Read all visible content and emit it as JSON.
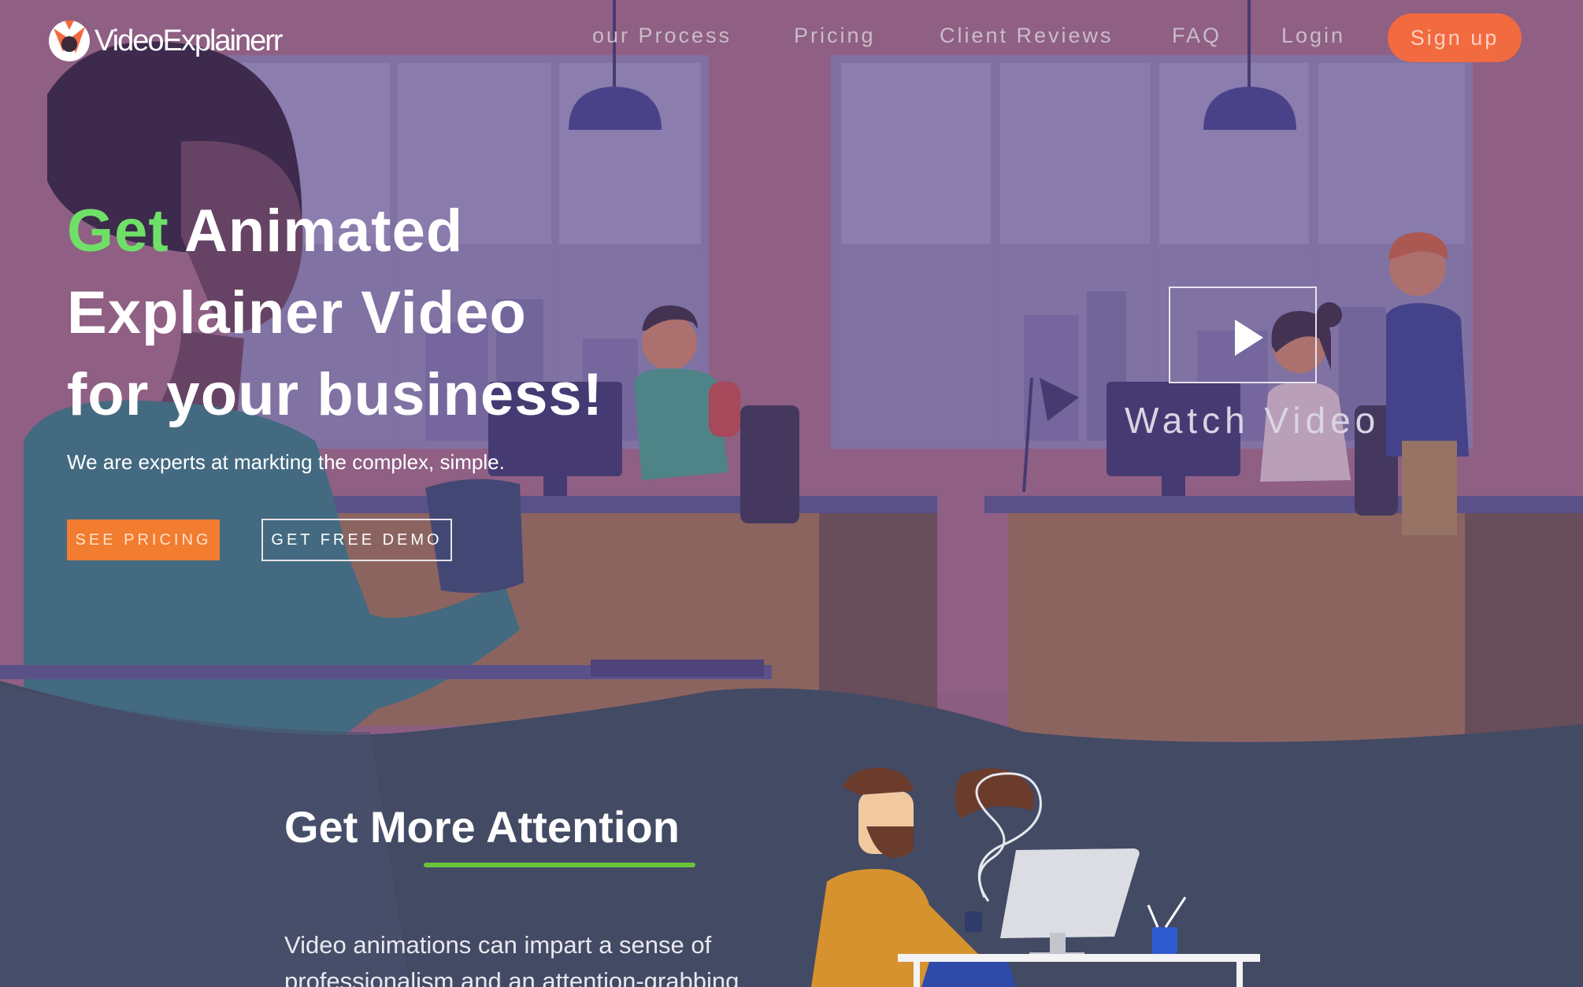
{
  "nav": {
    "logo_text": "VideoExplainerr",
    "links": [
      "our Process",
      "Pricing",
      "Client Reviews",
      "FAQ",
      "Login"
    ],
    "signup_label": "Sign up"
  },
  "hero": {
    "title_highlight": "Get",
    "title_line1_rest": " Animated",
    "title_line2": "Explainer Video",
    "title_line3": "for your business!",
    "subtitle": "We are experts at markting the complex, simple.",
    "primary_button": "SEE PRICING",
    "secondary_button": "GET FREE DEMO",
    "watch_label": "Watch Video"
  },
  "section": {
    "title": "Get More Attention",
    "body": "Video animations can impart a sense of professionalism and an attention-grabbing"
  },
  "colors": {
    "accent_orange": "#f27c2f",
    "signup_orange": "#f26a3f",
    "highlight_green": "#6fe067",
    "underline_green": "#6bc437",
    "section_bg": "#434a64",
    "hero_overlay": "#8a5f86"
  },
  "icons": {
    "logo": "fox-logo-icon",
    "play": "play-icon"
  }
}
